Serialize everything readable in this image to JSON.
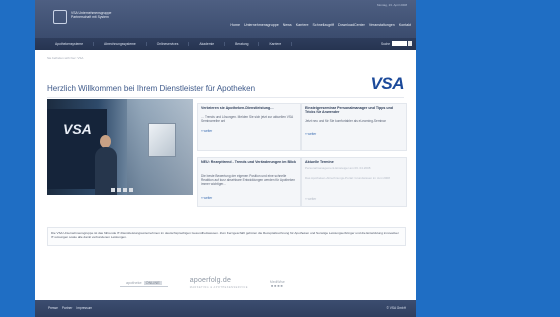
{
  "header": {
    "logo_line1": "VSA Unternehmensgruppe",
    "logo_line2": "Partnerschaft mit System",
    "date": "Montag, 23. April 2008",
    "top_nav": [
      "Home",
      "Unternehmensgruppe",
      "News",
      "Karriere",
      "Schnellzugriff",
      "DownloadCenter",
      "Veranstaltungen",
      "Kontakt"
    ]
  },
  "main_nav": {
    "items": [
      "Apothekensysteme",
      "Abrechnungssysteme",
      "Onlineservices",
      "Akademie",
      "Beratung",
      "Karriere"
    ],
    "search_label": "Suche"
  },
  "breadcrumb": "Sie befinden sich hier: VSA",
  "welcome_title": "Herzlich Willkommen bei Ihrem Dienstleister für Apotheken",
  "brand_logo": "VSA",
  "photo_logo": "VSA",
  "teasers": [
    {
      "title": "Verbrieren sie Apotheken-Dienstleistung…",
      "text": "… Trends und Lösungen. Melden Sie sich jetzt zur aktuellen VSA Seminarreihe an!",
      "more": "weiter"
    },
    {
      "title": "Einsteigerseminar Personalmanager und Tipps und Tricks für Anwender",
      "text": "Jetzt neu und für Sie komfortabler als eLearning-Seminar",
      "more": "weiter"
    },
    {
      "title": "NEU: Rezepttrend - Trends und Veränderungen im Blick",
      "text": "Die beste Bewertung der eigenen Position und eine schnelle Reaktion auf kurz absehbare Entwicklungen werden für Apotheken immer wichtiger...",
      "more": "weiter"
    }
  ],
  "termine": {
    "title": "Aktuelle Termine",
    "items": [
      "Personalmanagement-Einsteiger am 06. 04.2008",
      "Das Apotheken-Abrechnungs-Portal: Grundwissen im Juni 2008"
    ],
    "more": "weiter"
  },
  "info_text": "Die VSA Unternehmensgruppe ist das führende IT-Dienstleistungsunternehmen im deutschsprachigen Gesundheitswesen. Zum Kerngeschäft gehören die Rezeptabrechnung für Apotheken und Sonstige Leistungserbringer und die Entwicklung innovativer IT-Lösungen sowie alle damit verbundenen Leistungen.",
  "partners": {
    "apotheke_a": "apotheke",
    "apotheke_b": "ONLINE",
    "apoerfolg": "apoerfolg.de",
    "apoerfolg_sub": "MARKETING & APOTHEKENSERVICE",
    "mediwise": "MediWise",
    "mediwise_sub": "■■■■"
  },
  "footer": {
    "links": [
      "Presse",
      "Partner",
      "Impressum"
    ],
    "copyright": "© VSA GmbH"
  }
}
